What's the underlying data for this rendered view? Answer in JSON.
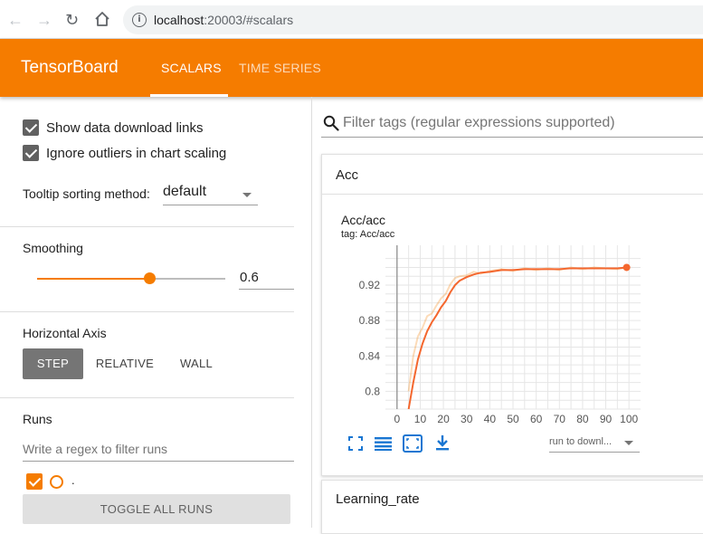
{
  "browser": {
    "url_host": "localhost",
    "url_rest": ":20003/#scalars"
  },
  "header": {
    "brand": "TensorBoard",
    "tabs": [
      {
        "label": "SCALARS",
        "active": true
      },
      {
        "label": "TIME SERIES",
        "active": false
      }
    ],
    "color": "#f57c00"
  },
  "sidebar": {
    "show_download_links": "Show data download links",
    "ignore_outliers": "Ignore outliers in chart scaling",
    "tooltip_label": "Tooltip sorting method:",
    "tooltip_value": "default",
    "smoothing_label": "Smoothing",
    "smoothing_value": "0.6",
    "smoothing_fraction": 0.6,
    "horizontal_axis_label": "Horizontal Axis",
    "axis_buttons": [
      {
        "label": "STEP",
        "active": true
      },
      {
        "label": "RELATIVE",
        "active": false
      },
      {
        "label": "WALL",
        "active": false
      }
    ],
    "runs_label": "Runs",
    "runs_placeholder": "Write a regex to filter runs",
    "run_name": ".",
    "toggle_all": "TOGGLE ALL RUNS"
  },
  "main": {
    "filter_placeholder": "Filter tags (regular expressions supported)",
    "sections": [
      {
        "title": "Acc"
      },
      {
        "title": "Learning_rate"
      }
    ],
    "chart": {
      "title": "Acc/acc",
      "subtitle": "tag: Acc/acc",
      "run_select": "run to downl..."
    }
  },
  "icons": {
    "back": "arrow-left-icon",
    "forward": "arrow-right-icon",
    "reload": "reload-icon",
    "home": "home-icon",
    "search": "search-icon",
    "fullscreen": "fullscreen-icon",
    "log_scale": "lines-icon",
    "fit_domain": "fit-domain-icon",
    "download": "download-icon"
  },
  "chart_data": {
    "type": "line",
    "title": "Acc/acc",
    "x_ticks": [
      0,
      10,
      20,
      30,
      40,
      50,
      60,
      70,
      80,
      90,
      100
    ],
    "y_ticks": [
      0.8,
      0.84,
      0.88,
      0.92
    ],
    "xlim": [
      -5,
      105
    ],
    "ylim": [
      0.78,
      0.965
    ],
    "grid": true,
    "color": "#f57c00",
    "series": [
      {
        "smoothed": true,
        "x": [
          5,
          7,
          9,
          11,
          13,
          15,
          17,
          19,
          21,
          23,
          25,
          27,
          30,
          33,
          36,
          40,
          45,
          50,
          55,
          60,
          65,
          70,
          75,
          80,
          85,
          90,
          95,
          99
        ],
        "y": [
          0.78,
          0.81,
          0.836,
          0.854,
          0.868,
          0.878,
          0.886,
          0.895,
          0.902,
          0.912,
          0.92,
          0.925,
          0.929,
          0.932,
          0.934,
          0.935,
          0.937,
          0.937,
          0.938,
          0.938,
          0.938,
          0.938,
          0.939,
          0.939,
          0.939,
          0.939,
          0.939,
          0.94
        ]
      },
      {
        "smoothed": false,
        "x": [
          5,
          7,
          9,
          11,
          13,
          15,
          17,
          19,
          21,
          23,
          25,
          27,
          30,
          33,
          36,
          40,
          45,
          50,
          55,
          60,
          65,
          70,
          75,
          80,
          85,
          90,
          95,
          99
        ],
        "y": [
          0.8,
          0.84,
          0.862,
          0.872,
          0.885,
          0.888,
          0.897,
          0.905,
          0.91,
          0.921,
          0.928,
          0.93,
          0.931,
          0.935,
          0.933,
          0.936,
          0.938,
          0.936,
          0.939,
          0.937,
          0.939,
          0.937,
          0.94,
          0.938,
          0.94,
          0.939,
          0.938,
          0.94
        ]
      }
    ]
  }
}
